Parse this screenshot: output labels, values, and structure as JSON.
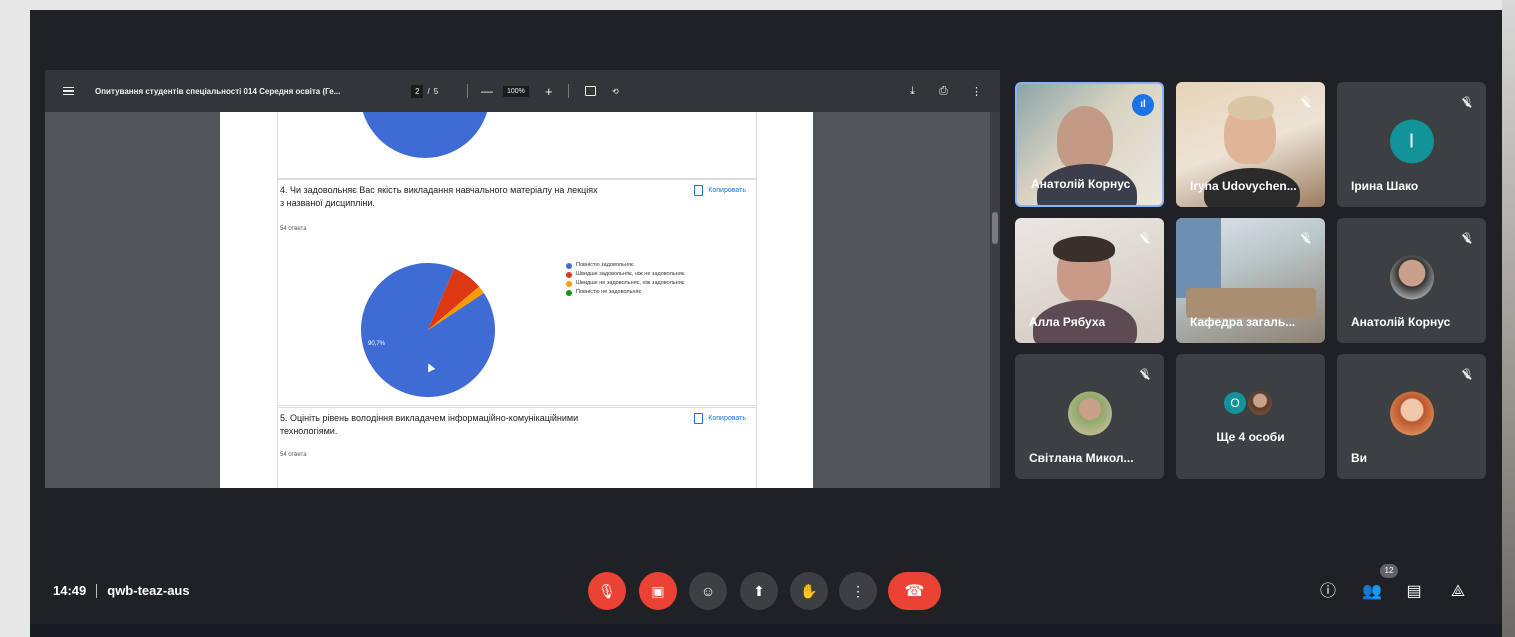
{
  "pdf_viewer": {
    "document_title": "Опитування студентів спеціальності 014 Середня освіта (Ге...",
    "page_current": "2",
    "page_separator": "/",
    "page_total": "5",
    "zoom_minus": "—",
    "zoom": "100%",
    "zoom_plus": "+",
    "icons": [
      "menu-icon",
      "fit-page-icon",
      "rotate-icon",
      "download-icon",
      "print-icon",
      "more-vert-icon"
    ]
  },
  "survey": {
    "copy_label": "Копировать",
    "question4": {
      "title": "4. Чи задовольняє Вас якість викладання навчального матеріалу на лекціях з названої дисципліни.",
      "responses": "54 ответа"
    },
    "question5": {
      "title": "5. Оцініть рівень володіння викладачем інформаційно-комунікаційними технологіями.",
      "responses": "54 ответа"
    }
  },
  "chart_data": {
    "type": "pie",
    "title": "",
    "categories": [
      "Повністю задовольняє",
      "Швидше задовольняє, ніж не задовольняє",
      "Швидше не задовольняє, ніж задовольняє",
      "Повністю не задовольняє"
    ],
    "values": [
      90.7,
      7.4,
      1.9,
      0
    ],
    "colors": [
      "#3e6bd4",
      "#dc3912",
      "#ff9900",
      "#109618"
    ],
    "data_labels": [
      "90,7%"
    ],
    "legend_position": "right"
  },
  "participants": [
    {
      "name": "Анатолій Корнус",
      "status": "speaking"
    },
    {
      "name": "Iryna Udovychen...",
      "status": "muted"
    },
    {
      "name": "Ірина Шако",
      "status": "muted",
      "initial": "І",
      "color": "#12939a"
    },
    {
      "name": "Алла Рябуха",
      "status": "muted"
    },
    {
      "name": "Кафедра загаль...",
      "status": "muted"
    },
    {
      "name": "Анатолій Корнус",
      "status": "muted"
    },
    {
      "name": "Світлана Микол...",
      "status": "muted"
    },
    {
      "name": "Ще 4 особи",
      "status": "group",
      "initial": "О"
    },
    {
      "name": "Ви",
      "status": "muted"
    }
  ],
  "bottom_bar": {
    "time": "14:49",
    "meeting_code": "qwb-teaz-aus",
    "people_count": "12",
    "controls": [
      "mic-off-icon",
      "camera-off-icon",
      "emoji-icon",
      "present-icon",
      "raise-hand-icon",
      "more-options-icon",
      "hang-up-icon"
    ],
    "right_controls": [
      "info-icon",
      "people-icon",
      "chat-icon",
      "activities-icon"
    ]
  },
  "colors": {
    "accent": "#1a73e8",
    "danger": "#ea4335",
    "surface": "#202124",
    "tile": "#3c4043"
  }
}
